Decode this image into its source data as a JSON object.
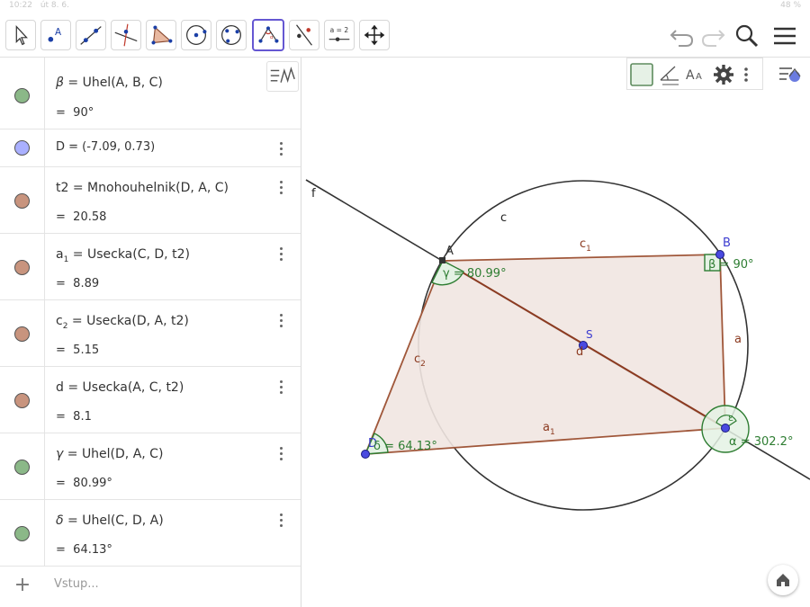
{
  "statusbar": {
    "time": "10:22",
    "date": "út 8. 6.",
    "battery": "48 %"
  },
  "toolbar": {
    "tools": [
      {
        "name": "move-tool",
        "icon": "cursor-arrow-icon"
      },
      {
        "name": "point-tool",
        "icon": "point-icon",
        "label": "A"
      },
      {
        "name": "line-tool",
        "icon": "line-icon"
      },
      {
        "name": "perpendicular-line-tool",
        "icon": "perpendicular-icon"
      },
      {
        "name": "polygon-tool",
        "icon": "polygon-icon"
      },
      {
        "name": "circle-center-point-tool",
        "icon": "circle-center-icon"
      },
      {
        "name": "circle-three-points-tool",
        "icon": "circle-three-points-icon"
      },
      {
        "name": "angle-tool",
        "icon": "angle-icon",
        "active": true
      },
      {
        "name": "reflect-tool",
        "icon": "reflect-line-icon"
      },
      {
        "name": "slider-tool",
        "icon": "slider-icon",
        "label": "a = 2"
      },
      {
        "name": "move-graphics-tool",
        "icon": "move-arrows-icon"
      }
    ],
    "undo": "undo-icon",
    "redo": "redo-icon",
    "search": "search-icon",
    "menu": "hamburger-menu-icon"
  },
  "algebra": {
    "rows": [
      {
        "name": "beta",
        "color": "#8bb888",
        "label": "β",
        "def": "Uhel(A, B, C)",
        "value": "90°"
      },
      {
        "name": "D",
        "color": "#aab0ff",
        "def": "D = (-7.09, 0.73)"
      },
      {
        "name": "t2",
        "color": "#c8947e",
        "label": "t2",
        "def": "Mnohouhelnik(D, A, C)",
        "value": "20.58"
      },
      {
        "name": "a1",
        "color": "#c8947e",
        "label": "a",
        "sub": "1",
        "def": "Usecka(C, D, t2)",
        "value": "8.89"
      },
      {
        "name": "c2",
        "color": "#c8947e",
        "label": "c",
        "sub": "2",
        "def": "Usecka(D, A, t2)",
        "value": "5.15"
      },
      {
        "name": "d",
        "color": "#c8947e",
        "label": "d",
        "def": "Usecka(A, C, t2)",
        "value": "8.1"
      },
      {
        "name": "gamma",
        "color": "#8bb888",
        "label": "γ",
        "def": "Uhel(D, A, C)",
        "value": "80.99°"
      },
      {
        "name": "delta",
        "color": "#8bb888",
        "label": "δ",
        "def": "Uhel(C, D, A)",
        "value": "64.13°"
      }
    ],
    "eq": "=",
    "input_placeholder": "Vstup..."
  },
  "graphics": {
    "labels": {
      "f": "f",
      "c": "c",
      "A": "A",
      "B": "B",
      "D": "D",
      "S": "S",
      "c1": "c",
      "c1_sub": "1",
      "c2": "c",
      "c2_sub": "2",
      "a": "a",
      "a1": "a",
      "a1_sub": "1",
      "d": "d",
      "gamma": "γ = 80.99°",
      "beta": "β = 90°",
      "delta": "δ = 64.13°",
      "alpha": "α = 302.2°",
      "eps": "ε"
    },
    "colors": {
      "polygon_fill": "#f1e6e1",
      "polygon_edge": "#a0573a",
      "angle": "#2e7d32",
      "angle_fill": "#e4f2e4",
      "point": "#4a4ae0",
      "line": "#333333"
    }
  },
  "style_bar": {
    "buttons": [
      "color-swatch-icon",
      "angle-style-icon",
      "text-size-icon",
      "settings-gear-icon",
      "more-options-icon",
      "toggle-view-icon"
    ]
  },
  "home": "home-icon"
}
